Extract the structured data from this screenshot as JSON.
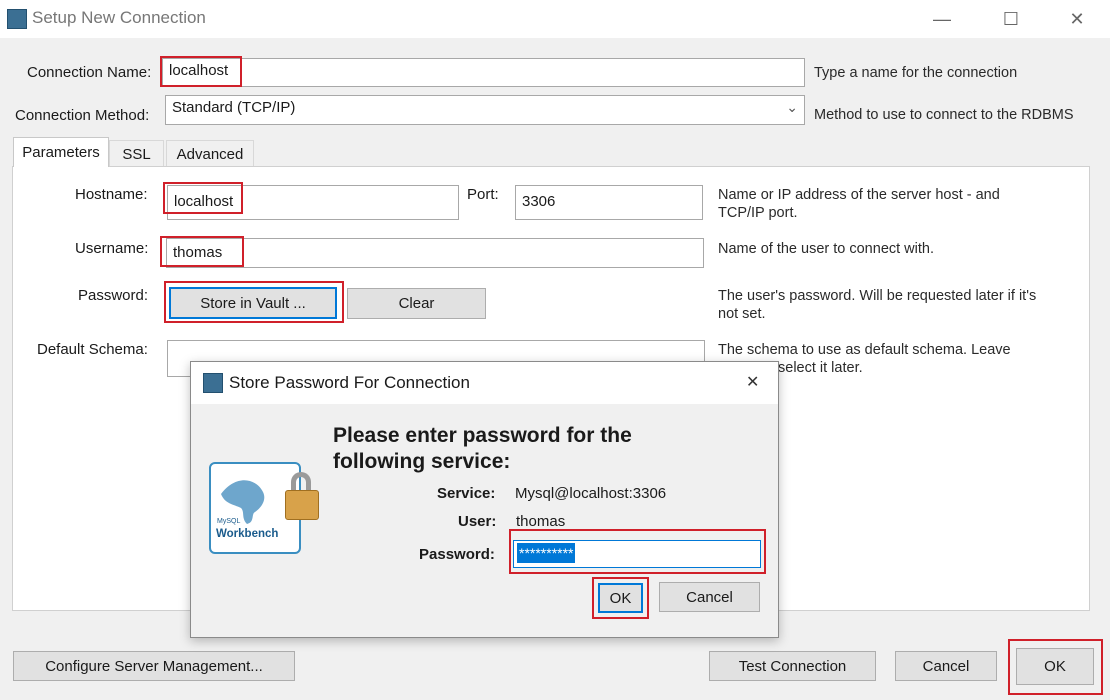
{
  "window": {
    "title": "Setup New Connection",
    "controls": {
      "minimize": "—",
      "maximize": "☐",
      "close": "✕"
    }
  },
  "form": {
    "connection_name": {
      "label": "Connection Name:",
      "value": "localhost",
      "hint": "Type a name for the connection"
    },
    "connection_method": {
      "label": "Connection Method:",
      "value": "Standard (TCP/IP)",
      "hint": "Method to use to connect to the RDBMS"
    }
  },
  "tabs": [
    {
      "label": "Parameters",
      "active": true
    },
    {
      "label": "SSL",
      "active": false
    },
    {
      "label": "Advanced",
      "active": false
    }
  ],
  "parameters": {
    "hostname": {
      "label": "Hostname:",
      "value": "localhost"
    },
    "port": {
      "label": "Port:",
      "value": "3306"
    },
    "host_hint_line1": "Name or IP address of the server host - and",
    "host_hint_line2": "TCP/IP port.",
    "username": {
      "label": "Username:",
      "value": "thomas",
      "hint": "Name of the user to connect with."
    },
    "password": {
      "label": "Password:",
      "store_button": "Store in Vault ...",
      "clear_button": "Clear",
      "hint_line1": "The user's password. Will be requested later if it's",
      "hint_line2": "not set."
    },
    "default_schema": {
      "label": "Default Schema:",
      "value": "",
      "hint_line1": "The schema to use as default schema. Leave",
      "hint_line2": "select it later."
    }
  },
  "bottom_buttons": {
    "configure": "Configure Server Management...",
    "test": "Test Connection",
    "cancel": "Cancel",
    "ok": "OK"
  },
  "password_dialog": {
    "title": "Store Password For Connection",
    "close": "✕",
    "heading_line1": "Please enter password for the",
    "heading_line2": "following service:",
    "service_label": "Service:",
    "service_value": "Mysql@localhost:3306",
    "user_label": "User:",
    "user_value": "thomas",
    "password_label": "Password:",
    "password_value": "**********",
    "ok": "OK",
    "cancel": "Cancel",
    "logo_text_top": "MySQL",
    "logo_text": "Workbench"
  },
  "colors": {
    "highlight_red": "#d0202a",
    "focus_blue": "#0078d7",
    "selection_blue": "#0078d7"
  }
}
